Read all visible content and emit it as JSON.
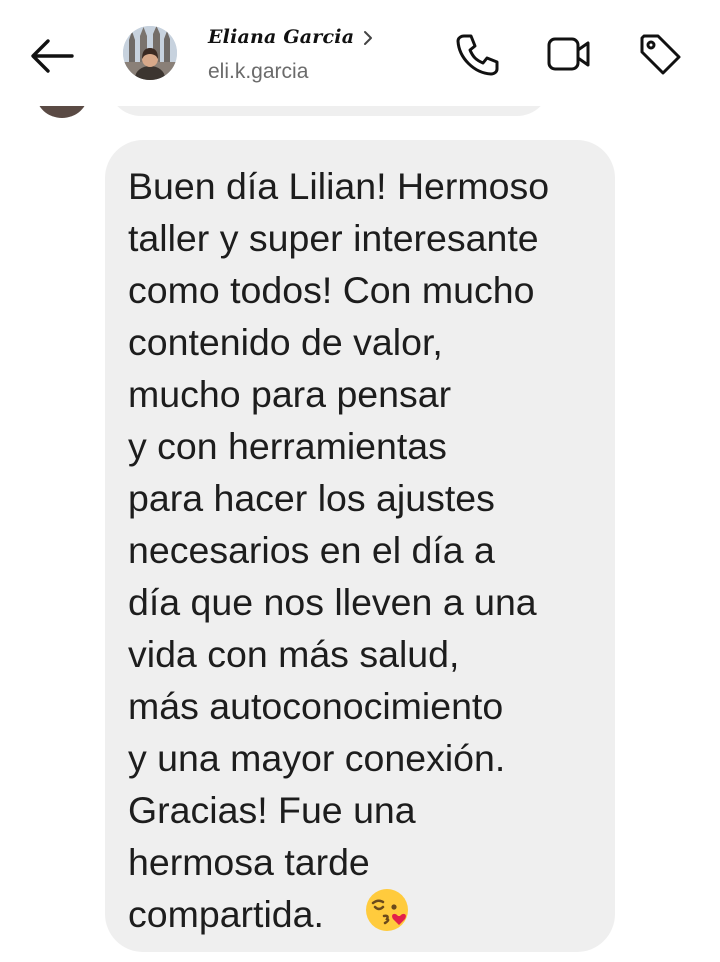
{
  "header": {
    "contact_name": "Eliana Garcia",
    "username": "eli.k.garcia",
    "icons": {
      "back": "arrow-left-icon",
      "chevron": "chevron-right-icon",
      "call": "phone-icon",
      "video": "video-camera-icon",
      "label": "tag-icon"
    }
  },
  "conversation": {
    "message_text": "Buen día Lilian! Hermoso\ntaller y super interesante\ncomo todos! Con mucho\ncontenido de valor,\nmucho para pensar\ny con herramientas\npara hacer los ajustes\nnecesarios en el día a\ndía que nos lleven a una\nvida con más salud,\nmás autoconocimiento\ny una mayor conexión.\nGracias! Fue una\nhermosa tarde\ncompartida.",
    "emoji": "face-blowing-kiss-emoji"
  },
  "colors": {
    "bubble": "#efefef",
    "text": "#1d1d1d",
    "secondary_text": "#6b6b6b",
    "icon": "#111111"
  }
}
